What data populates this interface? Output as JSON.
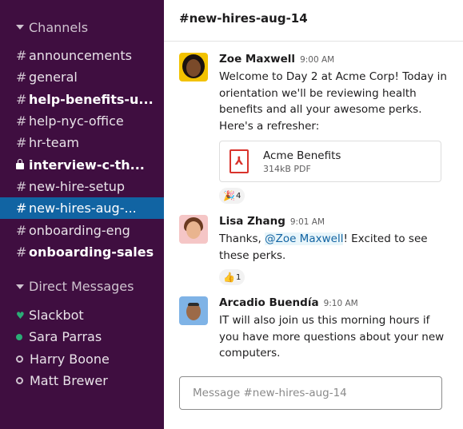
{
  "sidebar": {
    "channels_header": "Channels",
    "channels": [
      {
        "prefix": "#",
        "label": "announcements",
        "bold": false,
        "private": false,
        "active": false
      },
      {
        "prefix": "#",
        "label": "general",
        "bold": false,
        "private": false,
        "active": false
      },
      {
        "prefix": "#",
        "label": "help-benefits-u...",
        "bold": true,
        "private": false,
        "active": false
      },
      {
        "prefix": "#",
        "label": "help-nyc-office",
        "bold": false,
        "private": false,
        "active": false
      },
      {
        "prefix": "#",
        "label": "hr-team",
        "bold": false,
        "private": false,
        "active": false
      },
      {
        "prefix": "",
        "label": "interview-c-th...",
        "bold": true,
        "private": true,
        "active": false
      },
      {
        "prefix": "#",
        "label": "new-hire-setup",
        "bold": false,
        "private": false,
        "active": false
      },
      {
        "prefix": "#",
        "label": "new-hires-aug-...",
        "bold": false,
        "private": false,
        "active": true
      },
      {
        "prefix": "#",
        "label": "onboarding-eng",
        "bold": false,
        "private": false,
        "active": false
      },
      {
        "prefix": "#",
        "label": "onboarding-sales",
        "bold": true,
        "private": false,
        "active": false
      }
    ],
    "dm_header": "Direct Messages",
    "direct_messages": [
      {
        "name": "Slackbot",
        "status": "bot"
      },
      {
        "name": "Sara Parras",
        "status": "online"
      },
      {
        "name": "Harry Boone",
        "status": "away"
      },
      {
        "name": "Matt Brewer",
        "status": "away"
      }
    ]
  },
  "header": {
    "title": "#new-hires-aug-14"
  },
  "messages": [
    {
      "sender": "Zoe Maxwell",
      "time": "9:00 AM",
      "text": "Welcome to Day 2 at Acme Corp! Today in orientation we'll be reviewing health benefits and all your awesome perks. Here's a refresher:",
      "attachment": {
        "name": "Acme Benefits",
        "meta": "314kB PDF",
        "icon": "pdf-icon"
      },
      "reaction": {
        "emoji": "🎉",
        "count": "4"
      }
    },
    {
      "sender": "Lisa Zhang",
      "time": "9:01 AM",
      "text_before": "Thanks, ",
      "mention": "@Zoe Maxwell",
      "text_after": "! Excited to see these perks.",
      "reaction": {
        "emoji": "👍",
        "count": "1"
      }
    },
    {
      "sender": "Arcadio Buendía",
      "time": "9:10 AM",
      "text": "IT will also join us this morning hours if you have more questions about your new computers."
    }
  ],
  "composer": {
    "placeholder": "Message #new-hires-aug-14"
  },
  "colors": {
    "sidebar_bg": "#3f0e40",
    "active_channel": "#1164a3",
    "presence_online": "#2bac76",
    "mention": "#1264a3"
  }
}
